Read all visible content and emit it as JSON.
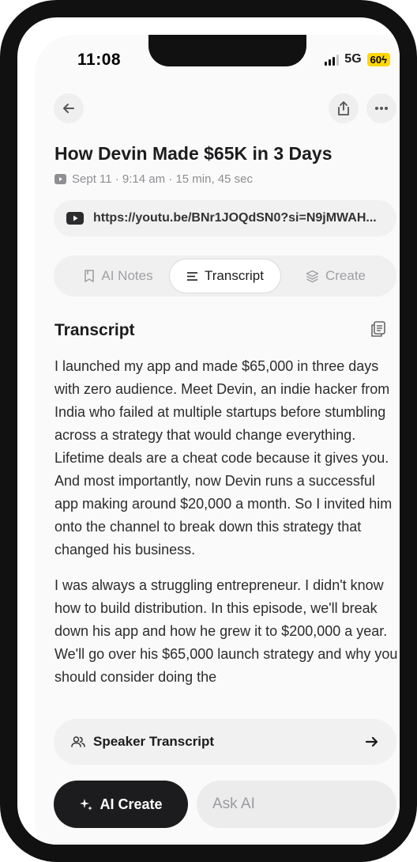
{
  "status_bar": {
    "time": "11:08",
    "network": "5G",
    "battery": "60"
  },
  "header": {
    "title": "How Devin Made $65K in 3 Days",
    "meta": "Sept 11 · 9:14 am · 15 min, 45 sec",
    "url": "https://youtu.be/BNr1JOQdSN0?si=N9jMWAH..."
  },
  "tabs": [
    {
      "label": "AI Notes",
      "icon": "bookmark-icon"
    },
    {
      "label": "Transcript",
      "icon": "lines-icon",
      "active": true
    },
    {
      "label": "Create",
      "icon": "layers-icon"
    }
  ],
  "section": {
    "title": "Transcript"
  },
  "transcript": {
    "paragraphs": [
      "I launched my app and made $65,000 in three days with zero audience. Meet Devin, an indie hacker from India who failed at multiple startups before stumbling across a strategy that would change everything. Lifetime deals are a cheat code because it gives you. And most importantly, now Devin runs a successful app making around $20,000 a month. So I invited him onto the channel to break down this strategy that changed his business.",
      "I was always a struggling entrepreneur. I didn't know how to build distribution. In this episode, we'll break down his app and how he grew it to $200,000 a year. We'll go over his $65,000 launch strategy and why you should consider doing the"
    ]
  },
  "speaker_transcript": {
    "label": "Speaker Transcript"
  },
  "bottom_bar": {
    "ai_create_label": "AI Create",
    "ask_placeholder": "Ask AI"
  }
}
